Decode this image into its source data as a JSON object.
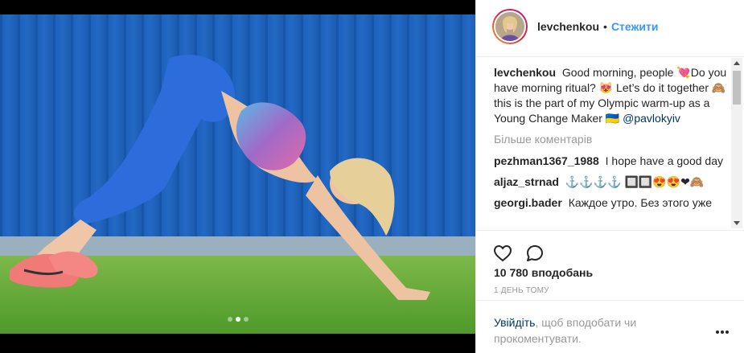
{
  "post": {
    "username": "levchenkou",
    "separator": "•",
    "follow_label": "Стежити",
    "caption": {
      "username": "levchenkou",
      "text": "Good morning, people 💘Do you have morning ritual? 😻 Let’s do it together 🙈 this is the part of my Olympic warm-up as a Young Change Maker 🇺🇦",
      "mention": "@pavlokyiv"
    },
    "more_comments": "Більше коментарів",
    "comments": [
      {
        "user": "pezhman1367_1988",
        "text": "I hope have a good day"
      },
      {
        "user": "aljaz_strnad",
        "text": "⚓⚓⚓⚓ 🔲🔲😍😍❤🙈"
      },
      {
        "user": "georgi.bader",
        "text": "Каждое утро. Без этого уже"
      }
    ],
    "likes": "10 780 вподобань",
    "time": "1 день тому",
    "login": {
      "link": "Увійдіть",
      "text": ", щоб вподобати чи прокоментувати."
    },
    "carousel": {
      "count": 3,
      "active": 1
    }
  },
  "icons": {
    "like": "heart-icon",
    "comment": "comment-bubble-icon",
    "more": "more-options-icon"
  },
  "colors": {
    "accent": "#3897f0",
    "link_dark": "#003569",
    "muted": "#999999",
    "text": "#262626"
  }
}
